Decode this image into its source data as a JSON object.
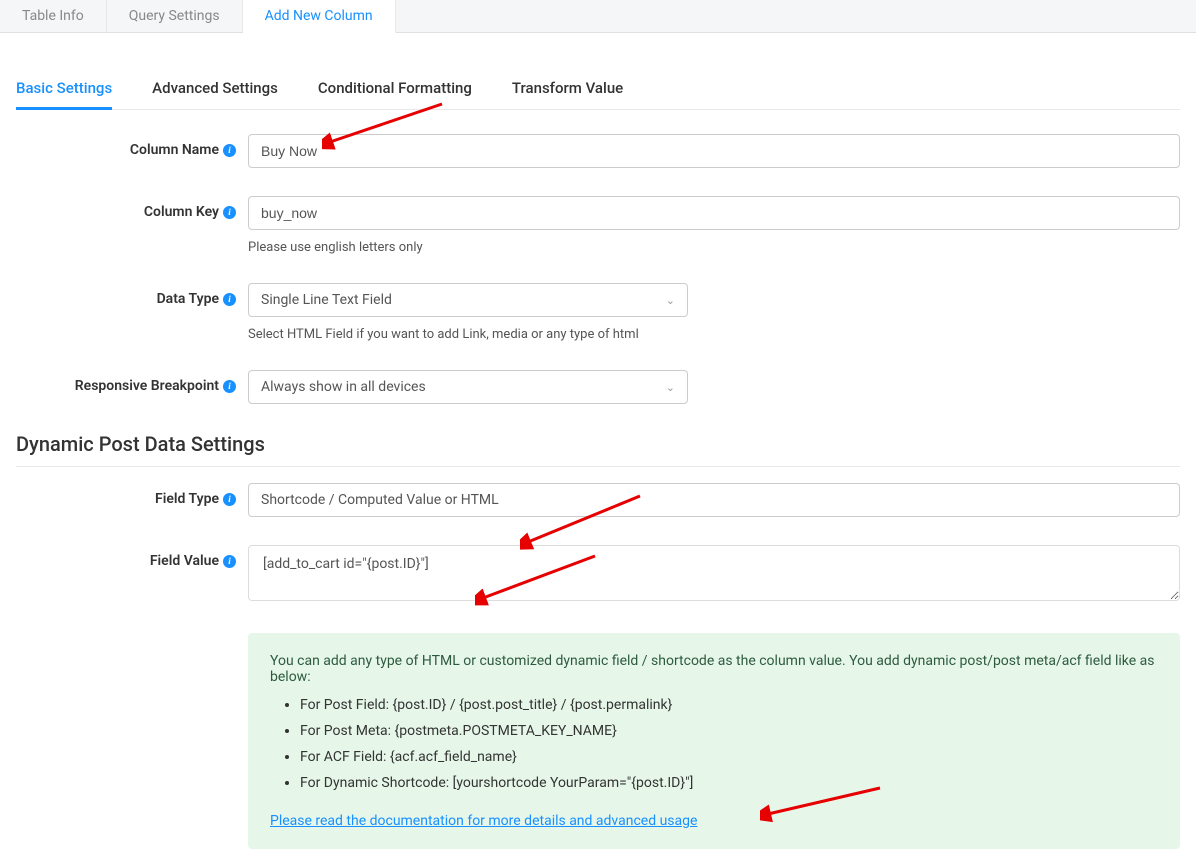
{
  "top_tabs": {
    "tab1": "Table Info",
    "tab2": "Query Settings",
    "tab3": "Add New Column"
  },
  "sub_tabs": {
    "tab1": "Basic Settings",
    "tab2": "Advanced Settings",
    "tab3": "Conditional Formatting",
    "tab4": "Transform Value"
  },
  "form": {
    "column_name": {
      "label": "Column Name",
      "value": "Buy Now"
    },
    "column_key": {
      "label": "Column Key",
      "value": "buy_now",
      "helper": "Please use english letters only"
    },
    "data_type": {
      "label": "Data Type",
      "value": "Single Line Text Field",
      "helper": "Select HTML Field if you want to add Link, media or any type of html"
    },
    "responsive_breakpoint": {
      "label": "Responsive Breakpoint",
      "value": "Always show in all devices"
    }
  },
  "dynamic_section": {
    "heading": "Dynamic Post Data Settings",
    "field_type": {
      "label": "Field Type",
      "value": "Shortcode / Computed Value or HTML"
    },
    "field_value": {
      "label": "Field Value",
      "value": "[add_to_cart id=\"{post.ID}\"]"
    }
  },
  "info_panel": {
    "intro": "You can add any type of HTML or customized dynamic field / shortcode as the column value. You add dynamic post/post meta/acf field like as below:",
    "item1": "For Post Field: {post.ID} / {post.post_title} / {post.permalink}",
    "item2": "For Post Meta: {postmeta.POSTMETA_KEY_NAME}",
    "item3": "For ACF Field: {acf.acf_field_name}",
    "item4": "For Dynamic Shortcode: [yourshortcode YourParam=\"{post.ID}\"]",
    "link": "Please read the documentation for more details and advanced usage"
  }
}
